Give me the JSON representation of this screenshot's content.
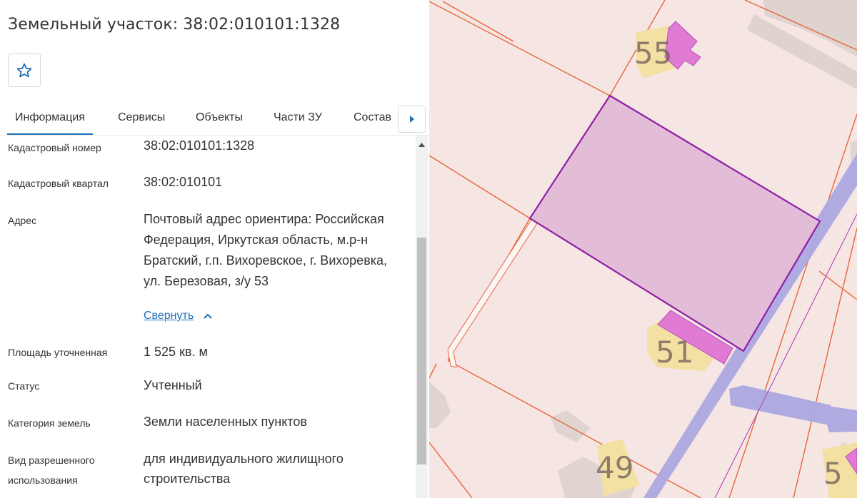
{
  "panel": {
    "title": "Земельный участок: 38:02:010101:1328",
    "favorite": {
      "icon": "star-icon"
    },
    "tabs": [
      {
        "label": "Информация",
        "active": true
      },
      {
        "label": "Сервисы",
        "active": false
      },
      {
        "label": "Объекты",
        "active": false
      },
      {
        "label": "Части ЗУ",
        "active": false
      },
      {
        "label": "Состав",
        "active": false
      }
    ],
    "tabs_next_icon": "caret-right-icon",
    "fields": [
      {
        "label": "Кадастровый номер",
        "value": "38:02:010101:1328"
      },
      {
        "label": "Кадастровый квартал",
        "value": "38:02:010101"
      },
      {
        "label": "Адрес",
        "value": "Почтовый адрес ориентира: Российская Федерация, Иркутская область, м.р-н Братский, г.п. Вихоревское, г. Вихоревка, ул. Березовая, з/у 53"
      },
      {
        "label": "Площадь уточненная",
        "value": "1 525 кв. м"
      },
      {
        "label": "Статус",
        "value": "Учтенный"
      },
      {
        "label": "Категория земель",
        "value": "Земли населенных пунктов"
      },
      {
        "label": "Вид разрешенного использования",
        "value": "для индивидуального жилищного строительства"
      }
    ],
    "collapse_link": "Свернуть"
  },
  "map": {
    "house_numbers": [
      "55",
      "51",
      "49",
      "5"
    ],
    "colors": {
      "background": "#f6e6e3",
      "parcel_border": "#e8643c",
      "selected_parcel_fill": "#e3bdd8",
      "selected_parcel_border": "#8e1fa8",
      "building_fill": "#e07ad2",
      "road": "#a9a6de",
      "accent": "#1e6fb8"
    }
  }
}
